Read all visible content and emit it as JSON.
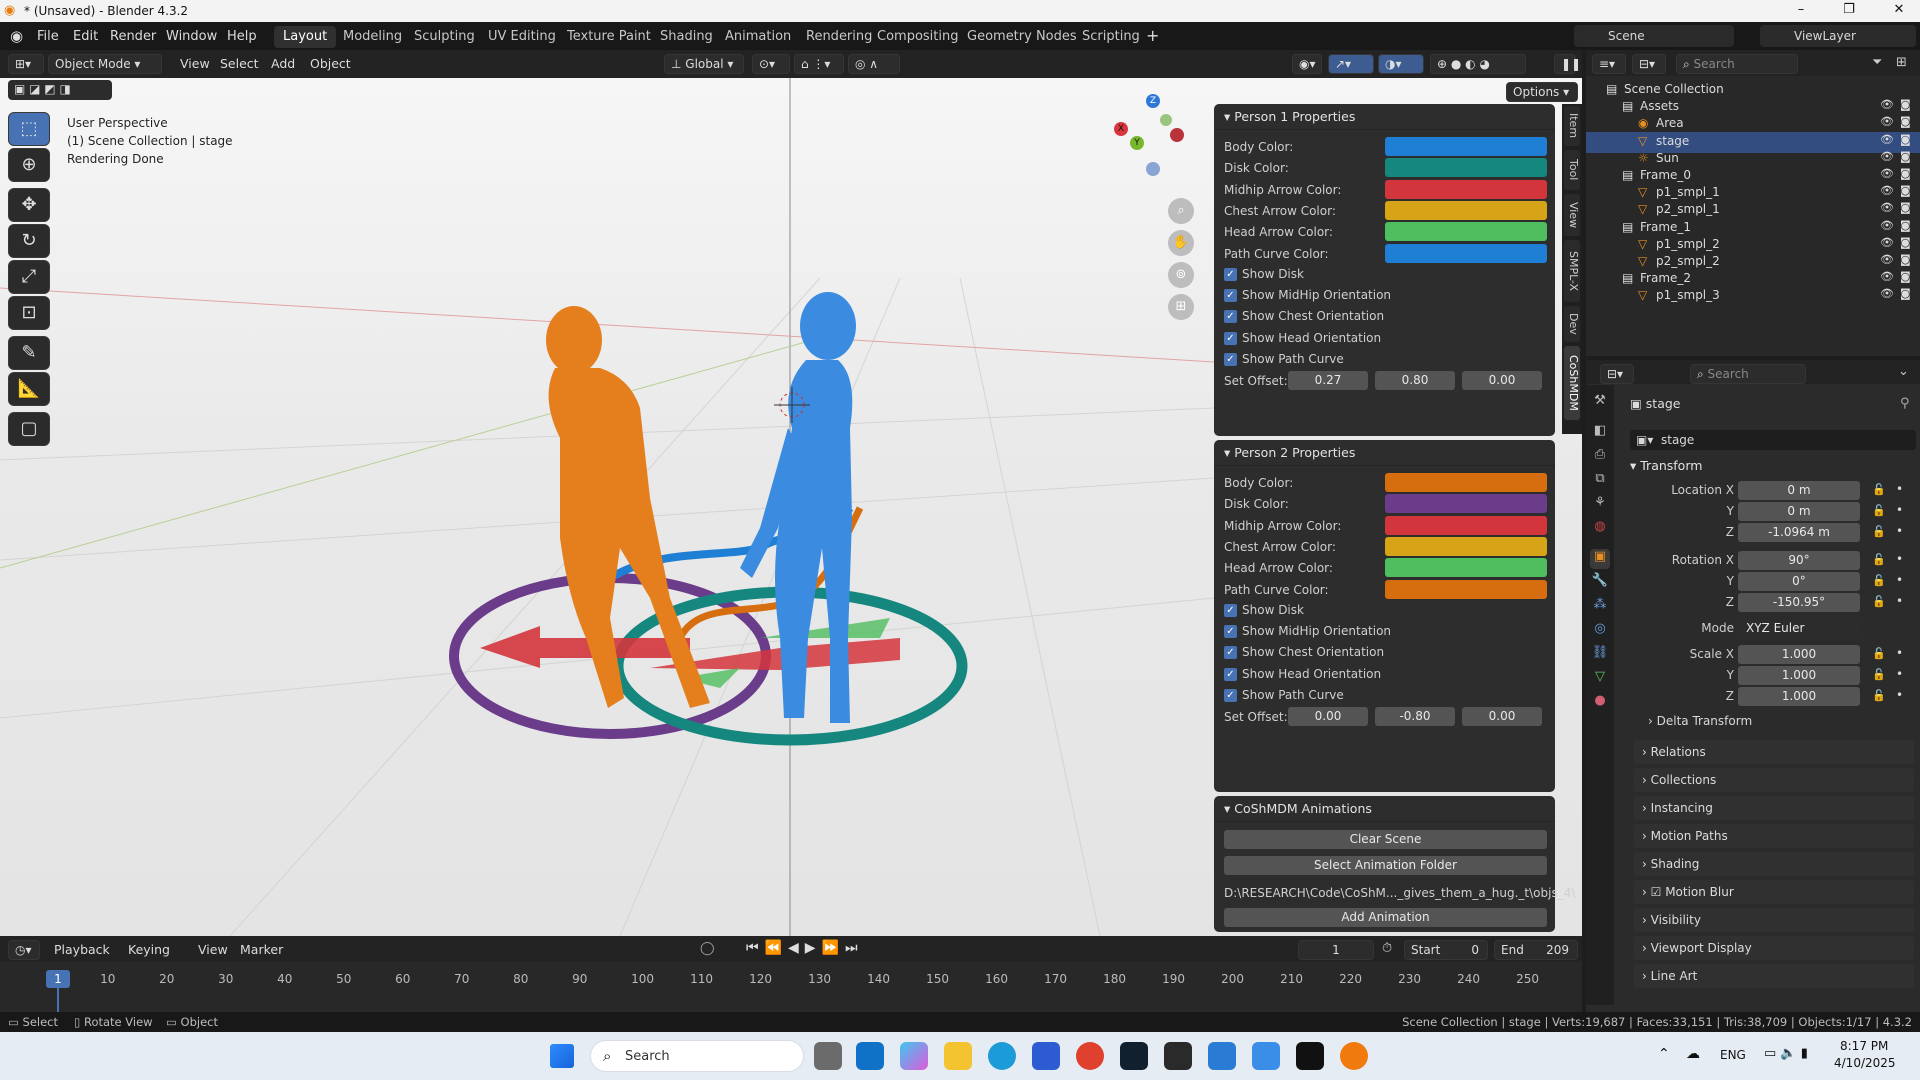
{
  "titlebar": {
    "title": "* (Unsaved) - Blender 4.3.2"
  },
  "menus": [
    "File",
    "Edit",
    "Render",
    "Window",
    "Help"
  ],
  "workspaces": [
    "Layout",
    "Modeling",
    "Sculpting",
    "UV Editing",
    "Texture Paint",
    "Shading",
    "Animation",
    "Rendering",
    "Compositing",
    "Geometry Nodes",
    "Scripting"
  ],
  "topright": {
    "scene": "Scene",
    "viewlayer": "ViewLayer"
  },
  "vpheader": {
    "mode": "Object Mode",
    "view": "View",
    "select": "Select",
    "add": "Add",
    "object": "Object",
    "transform": "Global",
    "options": "Options"
  },
  "overlay": {
    "line1": "User Perspective",
    "line2": "(1) Scene Collection | stage",
    "line3": "Rendering Done"
  },
  "gizmo": {
    "x": "X",
    "y": "Y",
    "z": "Z"
  },
  "sidetabs": [
    "Item",
    "Tool",
    "View",
    "SMPL-X",
    "Dev",
    "CoShMDM"
  ],
  "person1": {
    "header": "Person 1 Properties",
    "colors": [
      {
        "label": "Body Color:",
        "hex": "#1f7fd4"
      },
      {
        "label": "Disk Color:",
        "hex": "#16877f"
      },
      {
        "label": "Midhip Arrow Color:",
        "hex": "#d3353c"
      },
      {
        "label": "Chest Arrow Color:",
        "hex": "#d6a416"
      },
      {
        "label": "Head Arrow Color:",
        "hex": "#4fbe5f"
      },
      {
        "label": "Path Curve Color:",
        "hex": "#1f7fd4"
      }
    ],
    "checks": [
      "Show Disk",
      "Show MidHip Orientation",
      "Show Chest Orientation",
      "Show Head Orientation",
      "Show Path Curve"
    ],
    "offset_label": "Set Offset:",
    "offset": [
      "0.27",
      "0.80",
      "0.00"
    ]
  },
  "person2": {
    "header": "Person 2 Properties",
    "colors": [
      {
        "label": "Body Color:",
        "hex": "#d66e10"
      },
      {
        "label": "Disk Color:",
        "hex": "#6a3c8a"
      },
      {
        "label": "Midhip Arrow Color:",
        "hex": "#d3353c"
      },
      {
        "label": "Chest Arrow Color:",
        "hex": "#d6a416"
      },
      {
        "label": "Head Arrow Color:",
        "hex": "#4fbe5f"
      },
      {
        "label": "Path Curve Color:",
        "hex": "#d66e10"
      }
    ],
    "checks": [
      "Show Disk",
      "Show MidHip Orientation",
      "Show Chest Orientation",
      "Show Head Orientation",
      "Show Path Curve"
    ],
    "offset_label": "Set Offset:",
    "offset": [
      "0.00",
      "-0.80",
      "0.00"
    ]
  },
  "anims": {
    "header": "CoShMDM Animations",
    "clear": "Clear Scene",
    "select_folder": "Select Animation Folder",
    "path": "D:\\RESEARCH\\Code\\CoShM..._gives_them_a_hug._t\\objs_4\\",
    "add": "Add Animation"
  },
  "outliner": {
    "search": "Search",
    "rows": [
      "Scene Collection",
      "Assets",
      "Area",
      "stage",
      "Sun",
      "Frame_0",
      "p1_smpl_1",
      "p2_smpl_1",
      "Frame_1",
      "p1_smpl_2",
      "p2_smpl_2",
      "Frame_2",
      "p1_smpl_3"
    ]
  },
  "properties": {
    "search": "Search",
    "object_name": "stage",
    "data_name": "stage",
    "transform": "Transform",
    "loc_label": "Location X",
    "loc": [
      "0 m",
      "0 m",
      "-1.0964 m"
    ],
    "rot_label": "Rotation X",
    "rot": [
      "90°",
      "0°",
      "-150.95°"
    ],
    "mode_label": "Mode",
    "mode": "XYZ Euler",
    "scale_label": "Scale X",
    "scale": [
      "1.000",
      "1.000",
      "1.000"
    ],
    "y": "Y",
    "z": "Z",
    "delta": "Delta Transform",
    "subpanels": [
      "Relations",
      "Collections",
      "Instancing",
      "Motion Paths",
      "Shading",
      "Motion Blur",
      "Visibility",
      "Viewport Display",
      "Line Art"
    ]
  },
  "timeline": {
    "playback": "Playback",
    "keying": "Keying",
    "view": "View",
    "marker": "Marker",
    "current": "1",
    "start_label": "Start",
    "start": "0",
    "end_label": "End",
    "end": "209",
    "ticks": [
      "1",
      "10",
      "20",
      "30",
      "40",
      "50",
      "60",
      "70",
      "80",
      "90",
      "100",
      "110",
      "120",
      "130",
      "140",
      "150",
      "160",
      "170",
      "180",
      "190",
      "200",
      "210",
      "220",
      "230",
      "240",
      "250"
    ]
  },
  "status": {
    "select": "Select",
    "rotate": "Rotate View",
    "object": "Object",
    "stats": "Scene Collection | stage | Verts:19,687 | Faces:33,151 | Tris:38,709 | Objects:1/17 | 4.3.2"
  },
  "taskbar": {
    "search": "Search",
    "lang": "ENG",
    "time": "8:17 PM",
    "date": "4/10/2025"
  }
}
